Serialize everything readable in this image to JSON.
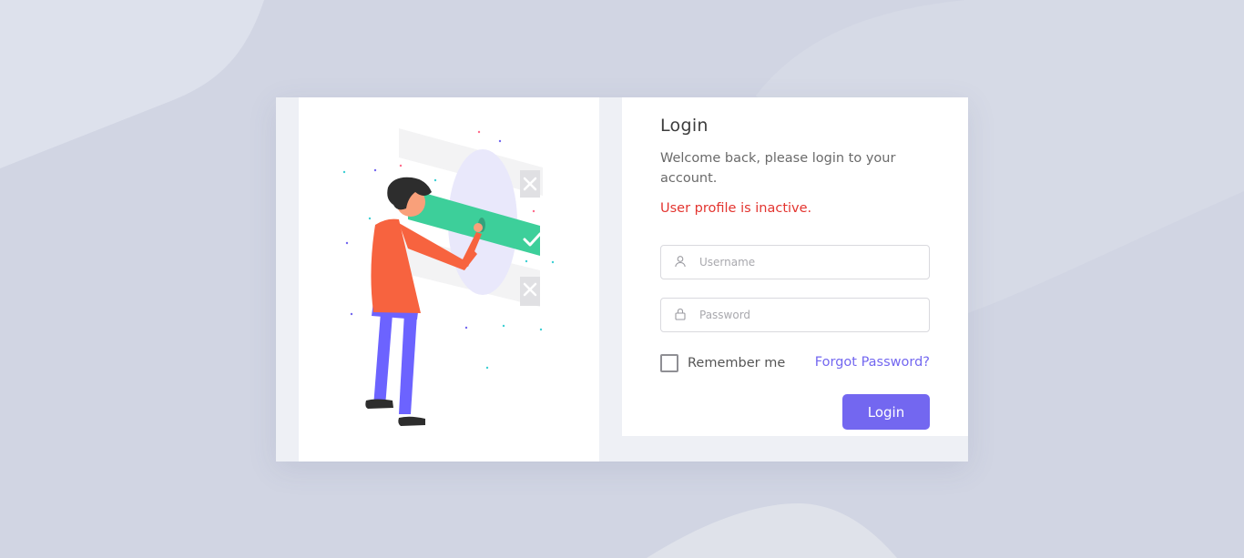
{
  "login": {
    "title": "Login",
    "welcome": "Welcome back, please login to your account.",
    "error": "User profile is inactive.",
    "username": {
      "placeholder": "Username",
      "value": ""
    },
    "password": {
      "placeholder": "Password",
      "value": ""
    },
    "remember_label": "Remember me",
    "remember_checked": false,
    "forgot_label": "Forgot Password?",
    "submit_label": "Login"
  },
  "colors": {
    "accent": "#7367f0",
    "error": "#e3342f",
    "background": "#d1d5e3",
    "success": "#3dcf9a"
  },
  "icons": {
    "username": "user-icon",
    "password": "lock-icon",
    "checkbox": "checkbox-unchecked"
  }
}
